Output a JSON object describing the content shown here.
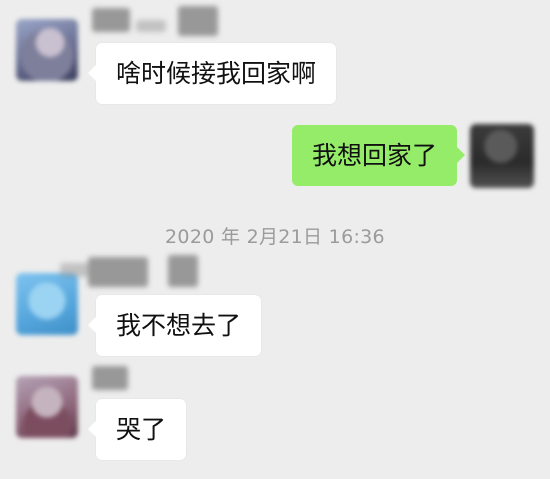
{
  "conversation": {
    "messages": [
      {
        "direction": "incoming",
        "text": "啥时候接我回家啊"
      },
      {
        "direction": "outgoing",
        "text": "我想回家了"
      },
      {
        "direction": "incoming",
        "text": "我不想去了"
      },
      {
        "direction": "incoming",
        "text": "哭了"
      }
    ],
    "timestamp": "2020 年 2月21日 16:36"
  },
  "colors": {
    "background": "#ededed",
    "incoming_bubble": "#ffffff",
    "outgoing_bubble": "#95ec69",
    "timestamp_text": "#9b9b9b",
    "message_text": "#111111"
  }
}
